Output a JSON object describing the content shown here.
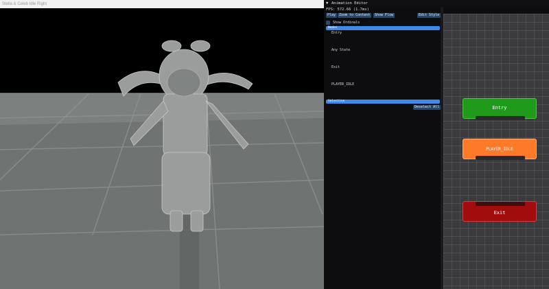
{
  "viewport": {
    "title": "Stella & Celeb Idle Right"
  },
  "editor": {
    "title": "Animation Editor",
    "fps_text": "FPS: 572.66 (1.7ms)",
    "buttons": {
      "play": "Play",
      "zoom": "Zoom to Content",
      "show_flow": "Show Flow",
      "edit_style": "Edit Style"
    },
    "show_ordinals_label": "Show Ordinals",
    "nodes_header": "Nodes",
    "node_list": [
      "Entry",
      "Any State",
      "Exit",
      "PLAYER_IDLE"
    ],
    "selection_header": "Selection",
    "deselect_all": "Deselect All"
  },
  "graph": {
    "nodes": [
      {
        "label": "Entry",
        "color": "#1f9a1a"
      },
      {
        "label": "PLAYER_IDLE",
        "color": "#ff7a28"
      },
      {
        "label": "Exit",
        "color": "#a20c0c"
      }
    ]
  },
  "colors": {
    "accent": "#3d8ae8",
    "button": "#254a72"
  }
}
